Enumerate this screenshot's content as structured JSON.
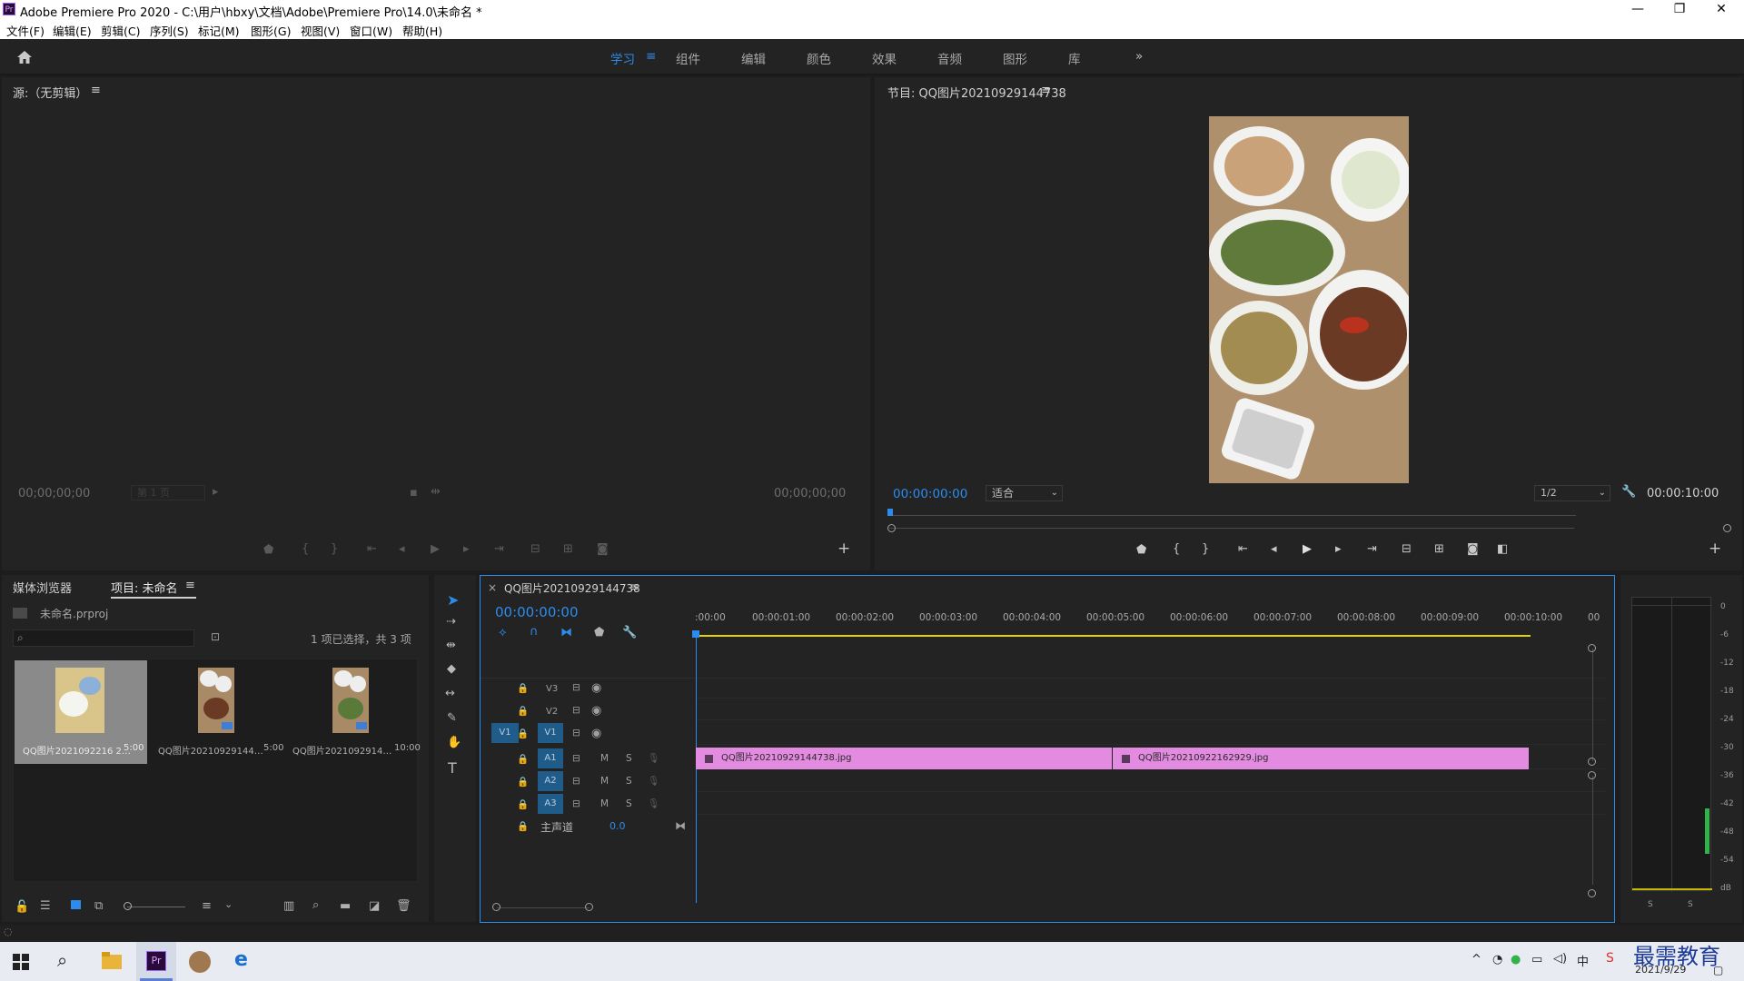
{
  "window": {
    "title": "Adobe Premiere Pro 2020 - C:\\用户\\hbxy\\文档\\Adobe\\Premiere Pro\\14.0\\未命名 *",
    "logo": "Pr",
    "minimize": "—",
    "restore": "❐",
    "close": "✕"
  },
  "menu": [
    "文件(F)",
    "编辑(E)",
    "剪辑(C)",
    "序列(S)",
    "标记(M)",
    "图形(G)",
    "视图(V)",
    "窗口(W)",
    "帮助(H)"
  ],
  "workspaces": {
    "items": [
      "学习",
      "组件",
      "编辑",
      "颜色",
      "效果",
      "音频",
      "图形",
      "库"
    ],
    "active_menu_icon": "≡",
    "more": "»"
  },
  "source_monitor": {
    "title": "源:（无剪辑）",
    "menu": "≡",
    "timecode_left": "00;00;00;00",
    "page_select": "第 1 页",
    "timecode_right": "00;00;00;00"
  },
  "program_monitor": {
    "title": "节目: QQ图片20210929144738",
    "menu": "≡",
    "timecode": "00:00:00:00",
    "fit": "适合",
    "resolution": "1/2",
    "duration": "00:00:10:00"
  },
  "project_panel": {
    "tab_media": "媒体浏览器",
    "tab_project": "项目: 未命名",
    "menu": "≡",
    "project_file": "未命名.prproj",
    "search_placeholder": "",
    "selection_info": "1 项已选择，共 3 项",
    "items": [
      {
        "name": "QQ图片2021092216 2...",
        "label": "QQ图片2021092216 2…",
        "duration": "5:00"
      },
      {
        "name": "QQ图片20210929144...",
        "label": "QQ图片20210929144…",
        "duration": "5:00"
      },
      {
        "name": "QQ图片2021092914...",
        "label": "QQ图片2021092914…",
        "duration": "10:00"
      }
    ]
  },
  "timeline": {
    "close": "×",
    "sequence_name": "QQ图片20210929144738",
    "menu": "≡",
    "timecode": "00:00:00:00",
    "ruler": [
      ":00:00",
      "00:00:01:00",
      "00:00:02:00",
      "00:00:03:00",
      "00:00:04:00",
      "00:00:05:00",
      "00:00:06:00",
      "00:00:07:00",
      "00:00:08:00",
      "00:00:09:00",
      "00:00:10:00",
      "00"
    ],
    "tracks": {
      "v3": "V3",
      "v2": "V2",
      "v1": "V1",
      "v1_source": "V1",
      "a1": "A1",
      "a2": "A2",
      "a3": "A3",
      "m": "M",
      "s": "S",
      "master": "主声道",
      "master_value": "0.0"
    },
    "clips": [
      {
        "name": "QQ图片20210929144738.jpg"
      },
      {
        "name": "QQ图片20210922162929.jpg"
      }
    ]
  },
  "audio_meter": {
    "scale": [
      "0",
      "-6",
      "-12",
      "-18",
      "-24",
      "-30",
      "-36",
      "-42",
      "-48",
      "-54",
      "dB"
    ],
    "solo_left": "S",
    "solo_right": "S"
  },
  "taskbar": {
    "date": "2021/9/29",
    "watermark": "最需教育",
    "ime": "中"
  },
  "colors": {
    "accent": "#2d8ceb",
    "clip": "#e38be0",
    "panel_bg": "#232323",
    "work_area": "#e5d300"
  }
}
